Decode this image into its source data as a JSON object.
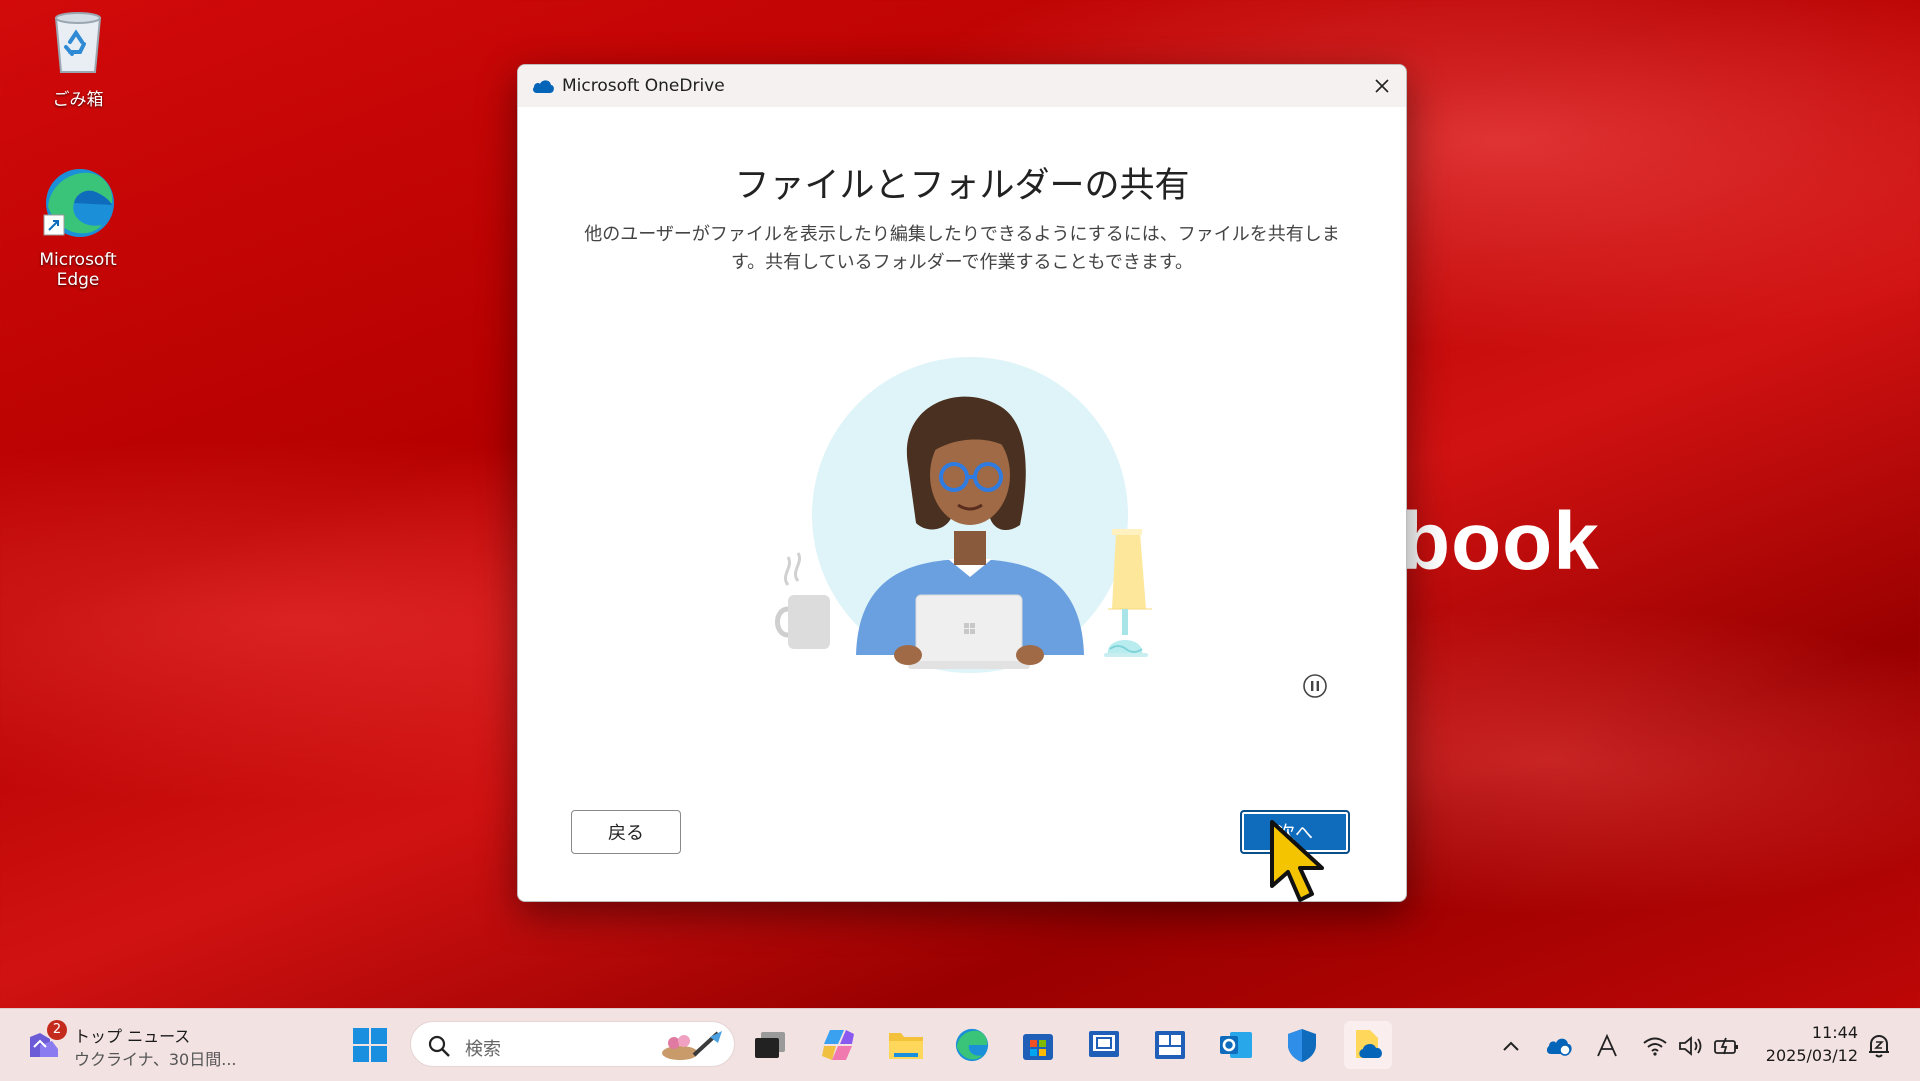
{
  "desktop": {
    "icons": [
      {
        "label": "ごみ箱"
      },
      {
        "label": "Microsoft Edge"
      }
    ],
    "wallpaper_text": "book"
  },
  "dialog": {
    "app_title": "Microsoft OneDrive",
    "heading": "ファイルとフォルダーの共有",
    "description": "他のユーザーがファイルを表示したり編集したりできるようにするには、ファイルを共有します。共有しているフォルダーで作業することもできます。",
    "back_label": "戻る",
    "next_label": "次へ"
  },
  "taskbar": {
    "news": {
      "badge": "2",
      "title": "トップ ニュース",
      "subtitle": "ウクライナ、30日間..."
    },
    "search_placeholder": "検索",
    "clock": {
      "time": "11:44",
      "date": "2025/03/12"
    }
  },
  "colors": {
    "accent": "#0f6cbd",
    "onedrive_blue": "#0364b8",
    "desktop_red": "#c40808"
  }
}
